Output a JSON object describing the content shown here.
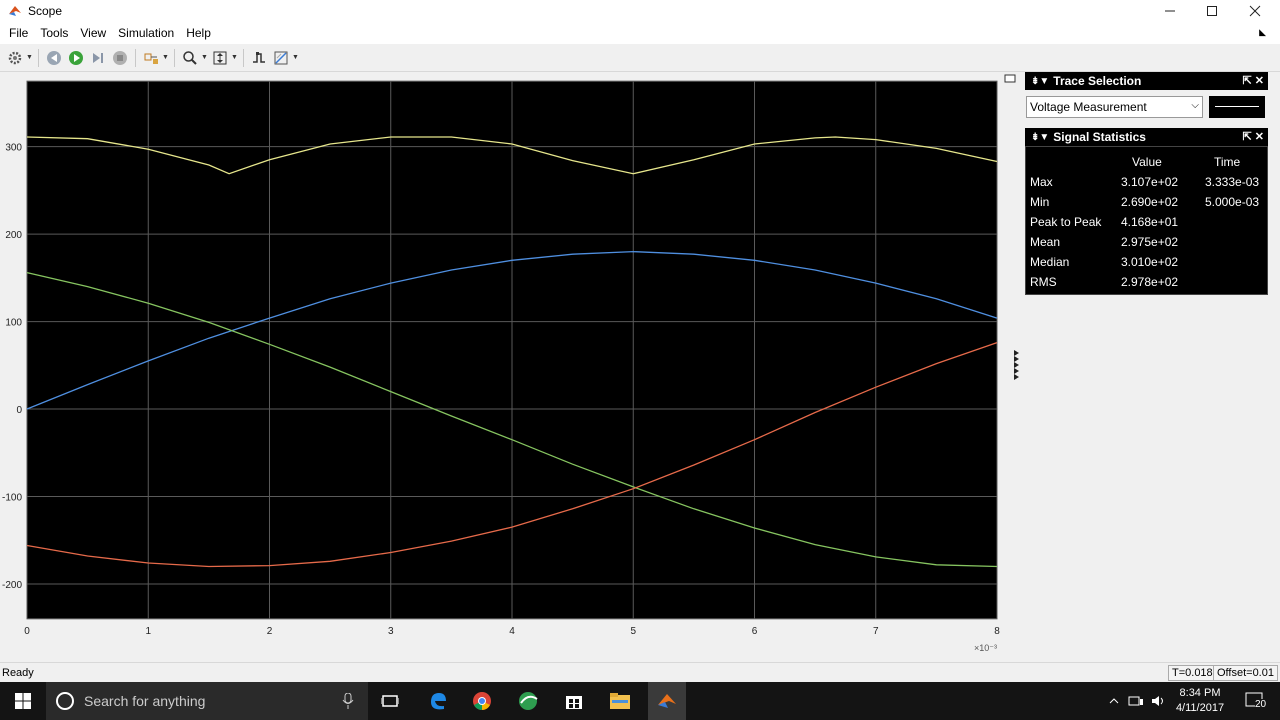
{
  "window": {
    "title": "Scope"
  },
  "menu": [
    "File",
    "Tools",
    "View",
    "Simulation",
    "Help"
  ],
  "trace_selection": {
    "title": "Trace Selection",
    "selected": "Voltage Measurement"
  },
  "signal_statistics": {
    "title": "Signal Statistics",
    "col_value": "Value",
    "col_time": "Time",
    "rows": [
      {
        "label": "Max",
        "value": "3.107e+02",
        "time": "3.333e-03"
      },
      {
        "label": "Min",
        "value": "2.690e+02",
        "time": "5.000e-03"
      },
      {
        "label": "Peak to Peak",
        "value": "4.168e+01",
        "time": ""
      },
      {
        "label": "Mean",
        "value": "2.975e+02",
        "time": ""
      },
      {
        "label": "Median",
        "value": "3.010e+02",
        "time": ""
      },
      {
        "label": "RMS",
        "value": "2.978e+02",
        "time": ""
      }
    ]
  },
  "status": {
    "left": "Ready",
    "time": "T=0.018",
    "offset": "Offset=0.01"
  },
  "taskbar": {
    "search_placeholder": "Search for anything",
    "clock_time": "8:34 PM",
    "clock_date": "4/11/2017",
    "notifications": "20"
  },
  "chart_data": {
    "type": "line",
    "title": "",
    "xlabel": "",
    "ylabel": "",
    "x_multiplier_label": "×10⁻³",
    "xlim": [
      0,
      8
    ],
    "ylim": [
      -240,
      375
    ],
    "x_ticks": [
      "0",
      "1",
      "2",
      "3",
      "4",
      "5",
      "6",
      "7",
      "8"
    ],
    "y_ticks": [
      "300",
      "200",
      "100",
      "0",
      "-100",
      "-200"
    ],
    "grid": true,
    "background": "#000000",
    "series": [
      {
        "color": "#e6e68c",
        "x": [
          0,
          0.5,
          1,
          1.5,
          1.667,
          2,
          2.5,
          3,
          3.333,
          3.5,
          4,
          4.5,
          5,
          5.5,
          6,
          6.5,
          6.667,
          7,
          7.5,
          8
        ],
        "y": [
          311,
          309,
          297,
          279,
          269,
          285,
          303,
          311,
          311,
          311,
          303,
          284,
          269,
          285,
          303,
          310,
          311,
          308,
          298,
          283
        ]
      },
      {
        "color": "#4f8fe0",
        "x": [
          0,
          0.5,
          1,
          1.5,
          2,
          2.5,
          3,
          3.5,
          4,
          4.5,
          5,
          5.5,
          6,
          6.5,
          7,
          7.5,
          8
        ],
        "y": [
          0,
          28,
          55,
          81,
          104,
          126,
          144,
          159,
          170,
          177,
          180,
          177,
          170,
          159,
          144,
          126,
          104
        ]
      },
      {
        "color": "#86c460",
        "x": [
          0,
          0.5,
          1,
          1.5,
          2,
          2.5,
          3,
          3.5,
          4,
          4.5,
          5,
          5.5,
          6,
          6.5,
          7,
          7.5,
          8
        ],
        "y": [
          156,
          140,
          121,
          99,
          74,
          48,
          20,
          -8,
          -35,
          -63,
          -89,
          -114,
          -136,
          -155,
          -169,
          -178,
          -180
        ]
      },
      {
        "color": "#e66a4a",
        "x": [
          0,
          0.5,
          1,
          1.5,
          2,
          2.5,
          3,
          3.5,
          4,
          4.5,
          5,
          5.5,
          6,
          6.5,
          7,
          7.5,
          8
        ],
        "y": [
          -156,
          -168,
          -176,
          -180,
          -179,
          -174,
          -164,
          -151,
          -135,
          -114,
          -91,
          -64,
          -35,
          -4,
          25,
          52,
          76
        ]
      }
    ]
  }
}
